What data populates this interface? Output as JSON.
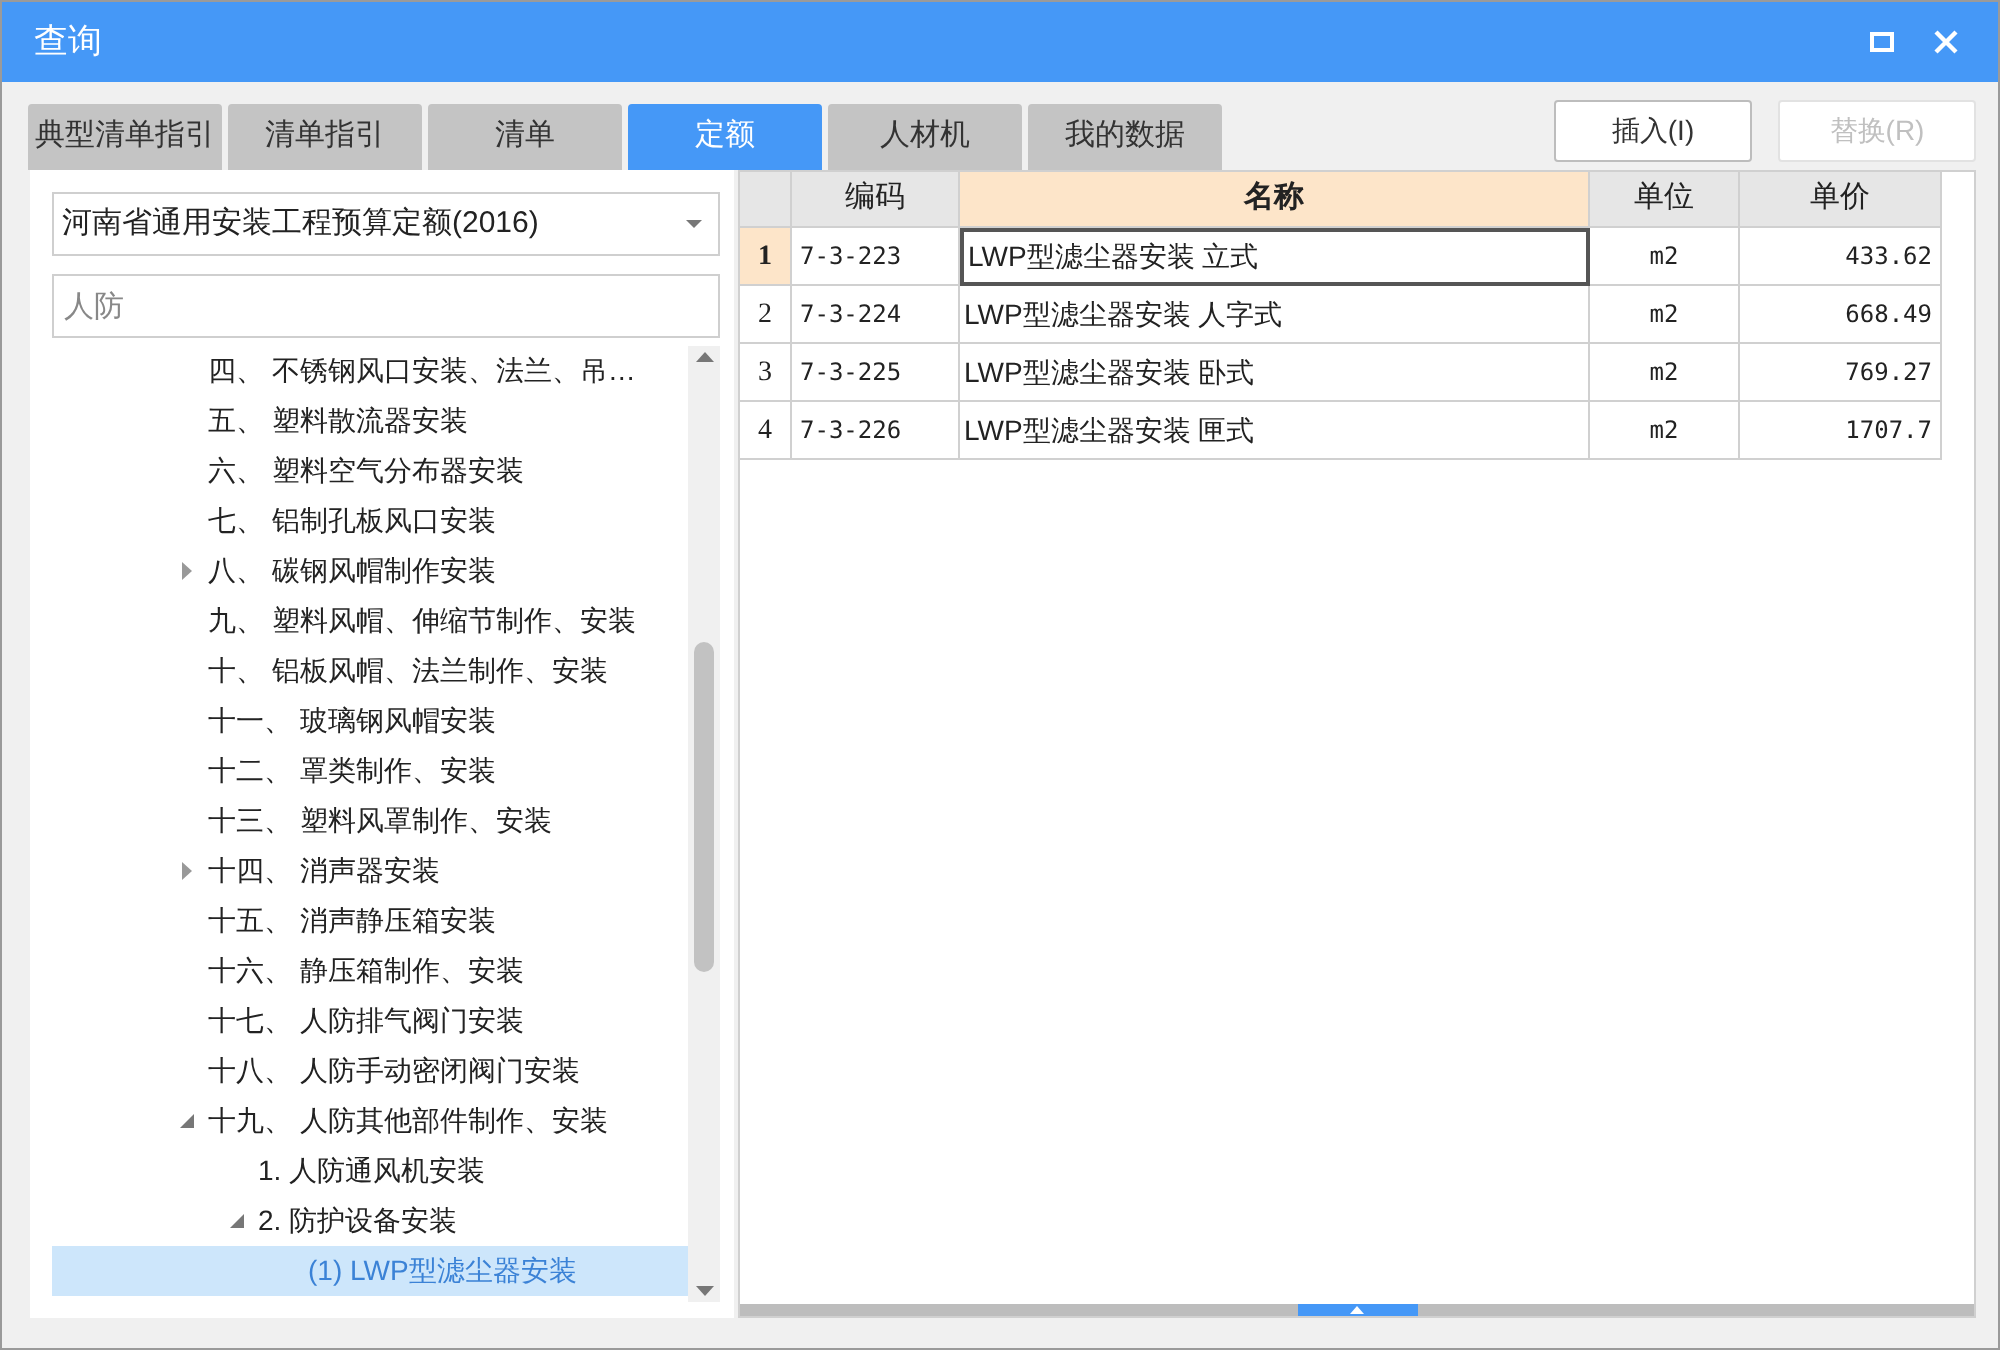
{
  "window": {
    "title": "查询"
  },
  "tabs": [
    {
      "label": "典型清单指引",
      "selected": false
    },
    {
      "label": "清单指引",
      "selected": false
    },
    {
      "label": "清单",
      "selected": false
    },
    {
      "label": "定额",
      "selected": true
    },
    {
      "label": "人材机",
      "selected": false
    },
    {
      "label": "我的数据",
      "selected": false
    }
  ],
  "buttons": [
    {
      "label": "插入(I)",
      "disabled": false
    },
    {
      "label": "替换(R)",
      "disabled": true
    }
  ],
  "library_select": {
    "value": "河南省通用安装工程预算定额(2016)"
  },
  "search": {
    "value": "人防"
  },
  "tree": [
    {
      "label": "四、 不锈钢风口安装、法兰、吊…",
      "selected": false
    },
    {
      "label": "五、 塑料散流器安装",
      "selected": false
    },
    {
      "label": "六、 塑料空气分布器安装",
      "selected": false
    },
    {
      "label": "七、 铝制孔板风口安装",
      "selected": false
    },
    {
      "label": "八、 碳钢风帽制作安装",
      "expanded": false,
      "selected": false
    },
    {
      "label": "九、 塑料风帽、伸缩节制作、安装",
      "selected": false
    },
    {
      "label": "十、 铝板风帽、法兰制作、安装",
      "selected": false
    },
    {
      "label": "十一、 玻璃钢风帽安装",
      "selected": false
    },
    {
      "label": "十二、 罩类制作、安装",
      "selected": false
    },
    {
      "label": "十三、 塑料风罩制作、安装",
      "selected": false
    },
    {
      "label": "十四、 消声器安装",
      "expanded": false,
      "selected": false
    },
    {
      "label": "十五、 消声静压箱安装",
      "selected": false
    },
    {
      "label": "十六、 静压箱制作、安装",
      "selected": false
    },
    {
      "label": "十七、 人防排气阀门安装",
      "selected": false
    },
    {
      "label": "十八、 人防手动密闭阀门安装",
      "selected": false
    },
    {
      "label": "十九、 人防其他部件制作、安装",
      "expanded": true,
      "selected": false,
      "children": [
        {
          "label": "1. 人防通风机安装",
          "selected": false
        },
        {
          "label": "2. 防护设备安装",
          "expanded": true,
          "selected": false,
          "children": [
            {
              "label": "(1) LWP型滤尘器安装",
              "selected": true
            }
          ]
        }
      ]
    }
  ],
  "table": {
    "columns": [
      "编码",
      "名称",
      "单位",
      "单价"
    ],
    "rows": [
      {
        "index": "1",
        "code": "7-3-223",
        "name": "LWP型滤尘器安装 立式",
        "unit": "m2",
        "price": "433.62",
        "selected": true
      },
      {
        "index": "2",
        "code": "7-3-224",
        "name": "LWP型滤尘器安装 人字式",
        "unit": "m2",
        "price": "668.49",
        "selected": false
      },
      {
        "index": "3",
        "code": "7-3-225",
        "name": "LWP型滤尘器安装 卧式",
        "unit": "m2",
        "price": "769.27",
        "selected": false
      },
      {
        "index": "4",
        "code": "7-3-226",
        "name": "LWP型滤尘器安装 匣式",
        "unit": "m2",
        "price": "1707.7",
        "selected": false
      }
    ]
  }
}
